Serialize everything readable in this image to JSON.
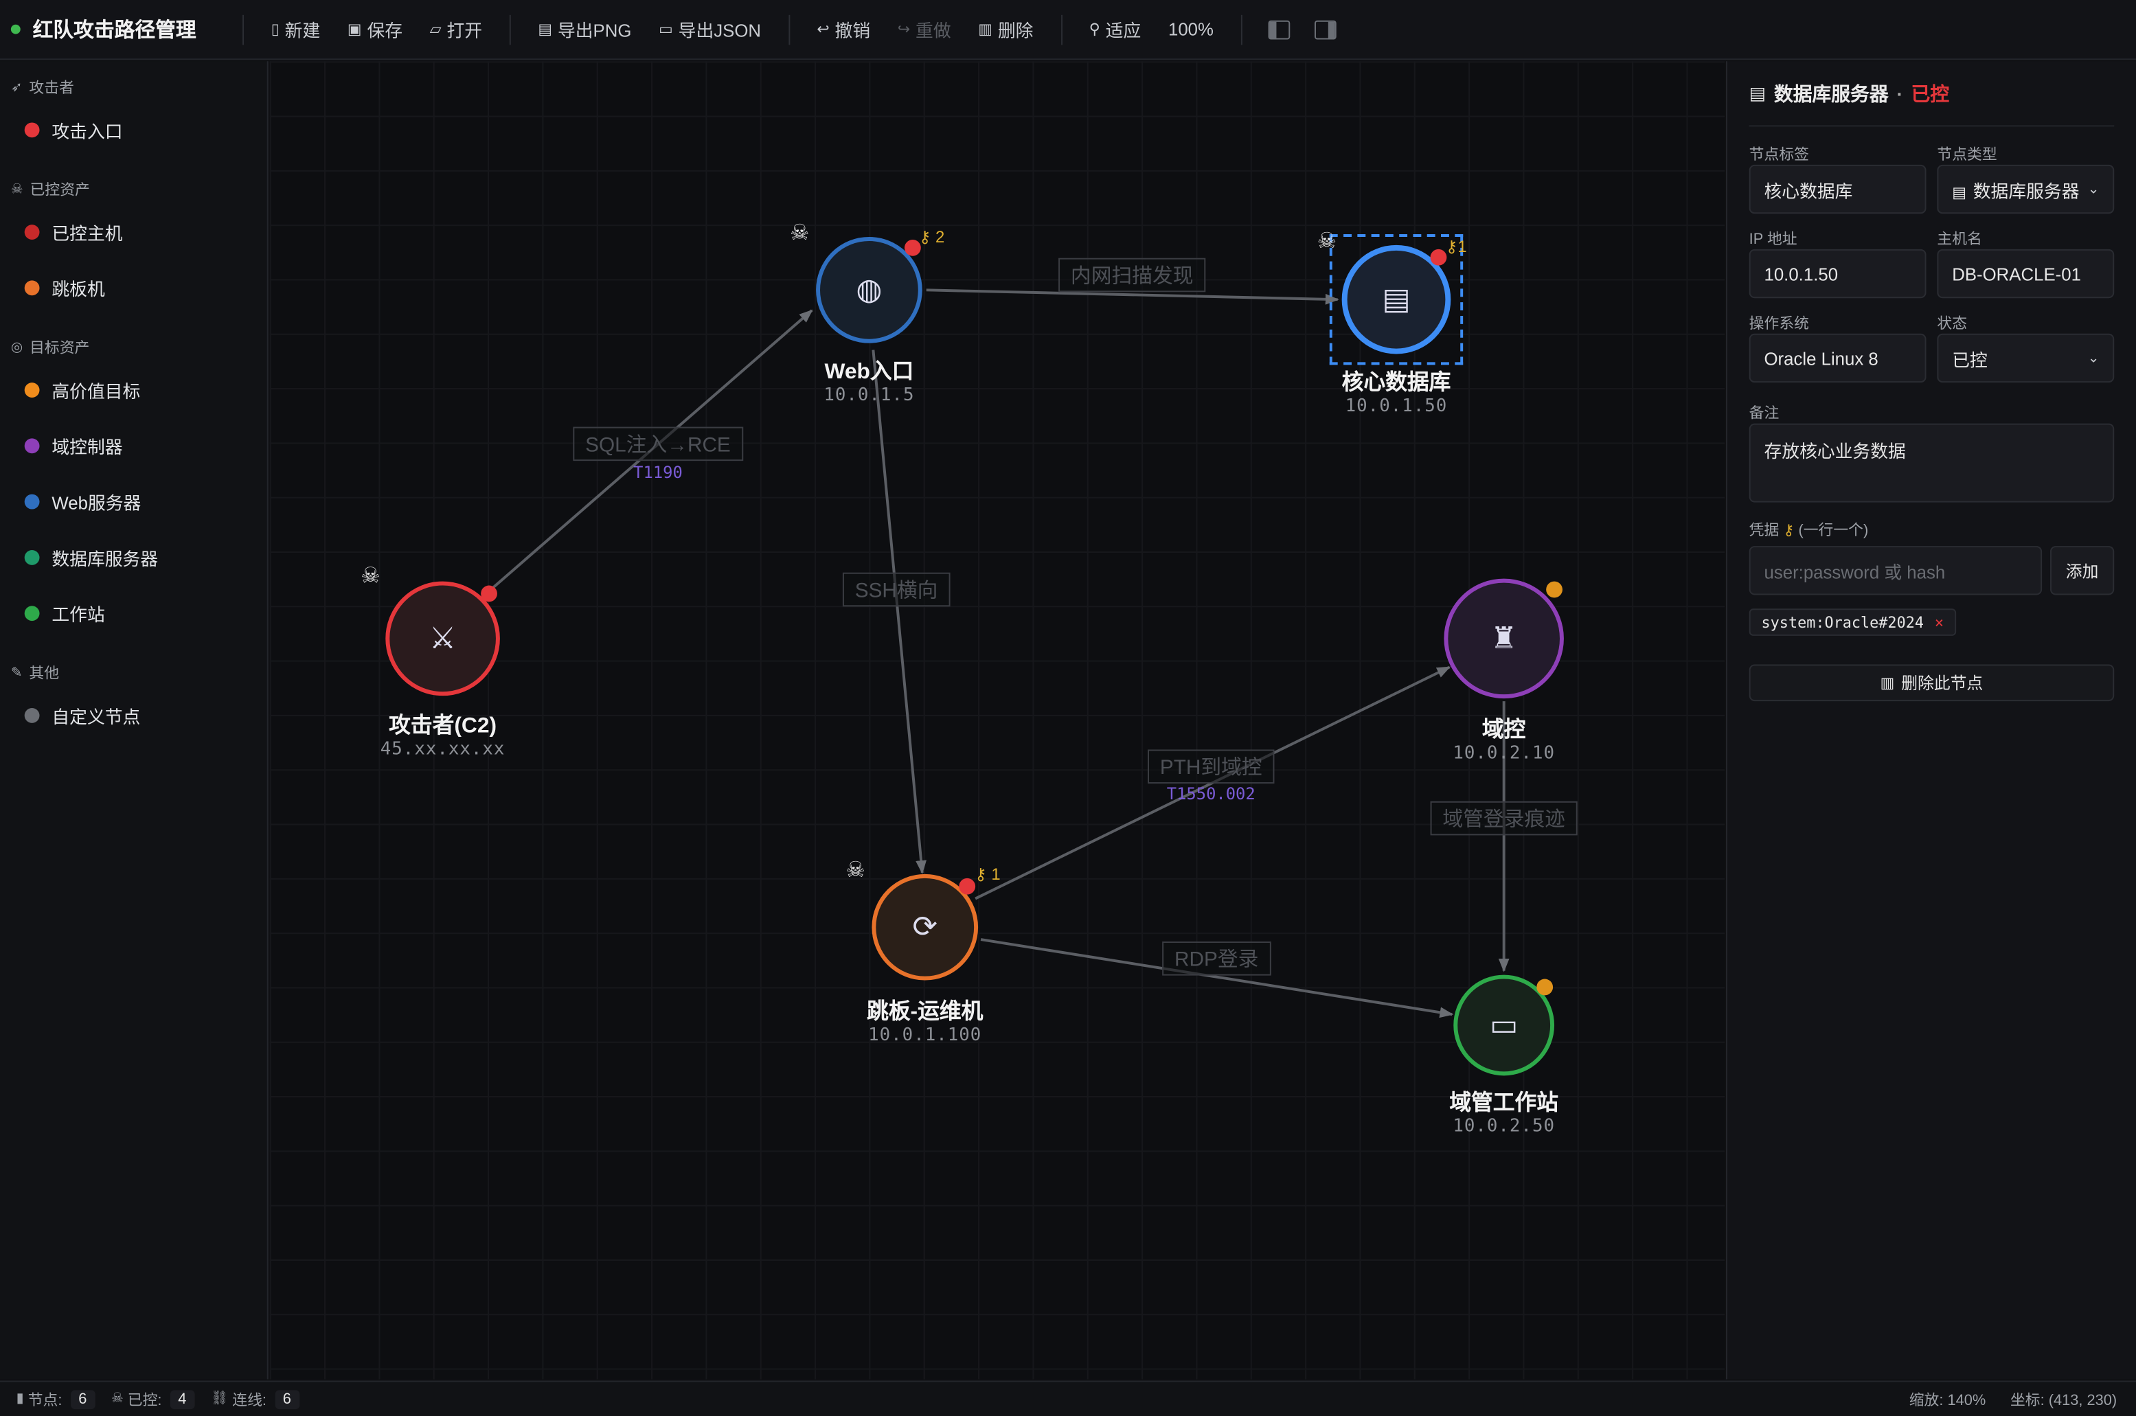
{
  "toolbar": {
    "title": "红队攻击路径管理",
    "new_label": "新建",
    "save_label": "保存",
    "open_label": "打开",
    "export_png_label": "导出PNG",
    "export_json_label": "导出JSON",
    "undo_label": "撤销",
    "redo_label": "重做",
    "delete_label": "删除",
    "fit_label": "适应",
    "zoom": "100%"
  },
  "sidebar": {
    "categories": [
      {
        "title": "攻击者",
        "items": [
          {
            "label": "攻击入口",
            "color": "#e5373b"
          }
        ]
      },
      {
        "title": "已控资产",
        "items": [
          {
            "label": "已控主机",
            "color": "#c92a2a"
          },
          {
            "label": "跳板机",
            "color": "#e8722a"
          }
        ]
      },
      {
        "title": "目标资产",
        "items": [
          {
            "label": "高价值目标",
            "color": "#f08c1c"
          },
          {
            "label": "域控制器",
            "color": "#8e3fb8"
          },
          {
            "label": "Web服务器",
            "color": "#2f6fc0"
          },
          {
            "label": "数据库服务器",
            "color": "#1f9a6a"
          },
          {
            "label": "工作站",
            "color": "#2eaa4a"
          }
        ]
      },
      {
        "title": "其他",
        "items": [
          {
            "label": "自定义节点",
            "color": "#6b6e74"
          }
        ]
      }
    ]
  },
  "canvas": {
    "nodes": [
      {
        "id": "attacker",
        "label": "攻击者(C2)",
        "ip": "45.xx.xx.xx",
        "icon": "crossed-swords-icon"
      },
      {
        "id": "web",
        "label": "Web入口",
        "ip": "10.0.1.5",
        "icon": "globe-icon",
        "creds": "2"
      },
      {
        "id": "db",
        "label": "核心数据库",
        "ip": "10.0.1.50",
        "icon": "file-cabinet-icon",
        "creds": "1"
      },
      {
        "id": "dc",
        "label": "域控",
        "ip": "10.0.2.10",
        "icon": "castle-icon"
      },
      {
        "id": "jump",
        "label": "跳板-运维机",
        "ip": "10.0.1.100",
        "icon": "refresh-icon",
        "creds": "1"
      },
      {
        "id": "ws",
        "label": "域管工作站",
        "ip": "10.0.2.50",
        "icon": "laptop-icon"
      }
    ],
    "edges": [
      {
        "label": "SQL注入→RCE",
        "technique": "T1190"
      },
      {
        "label": "内网扫描发现",
        "technique": ""
      },
      {
        "label": "SSH横向",
        "technique": ""
      },
      {
        "label": "PTH到域控",
        "technique": "T1550.002"
      },
      {
        "label": "域管登录痕迹",
        "technique": ""
      },
      {
        "label": "RDP登录",
        "technique": ""
      }
    ]
  },
  "panel": {
    "title": "数据库服务器",
    "status_title": "已控",
    "label_field": "节点标签",
    "label_value": "核心数据库",
    "type_field": "节点类型",
    "type_value": "数据库服务器",
    "ip_field": "IP 地址",
    "ip_value": "10.0.1.50",
    "hostname_field": "主机名",
    "hostname_value": "DB-ORACLE-01",
    "os_field": "操作系统",
    "os_value": "Oracle Linux 8",
    "status_field": "状态",
    "status_value": "已控",
    "notes_field": "备注",
    "notes_value": "存放核心业务数据",
    "creds_field": "凭据",
    "creds_hint": "(一行一个)",
    "creds_placeholder": "user:password 或 hash",
    "add_label": "添加",
    "cred_tag": "system:Oracle#2024",
    "delete_label": "删除此节点"
  },
  "statusbar": {
    "nodes_label": "节点:",
    "nodes_value": "6",
    "controlled_label": "已控:",
    "controlled_value": "4",
    "edges_label": "连线:",
    "edges_value": "6",
    "zoom_text": "缩放: 140%",
    "coords_text": "坐标: (413, 230)"
  },
  "colors": {
    "attacker": "#e5373b",
    "web": "#2f6fc0",
    "db": "#3d8df5",
    "dc": "#8e3fb8",
    "jump": "#e8722a",
    "ws": "#2eaa4a",
    "controlled": "#e5373b",
    "technique": "#7a5bd6"
  }
}
